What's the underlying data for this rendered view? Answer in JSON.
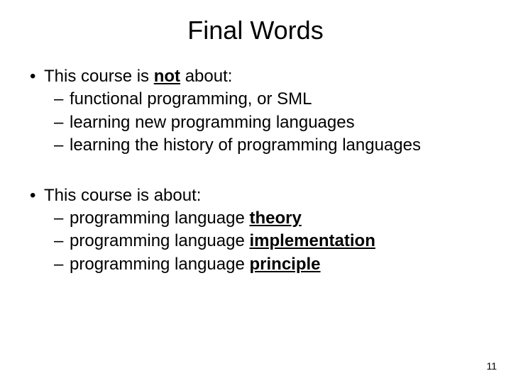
{
  "title": "Final Words",
  "section1": {
    "intro_pre": "This course is ",
    "intro_em": "not",
    "intro_post": " about:",
    "items": [
      "functional programming, or SML",
      "learning new programming languages",
      "learning the history of programming languages"
    ]
  },
  "section2": {
    "intro": "This course is about:",
    "items_pre": "programming language ",
    "items_em": [
      "theory",
      "implementation",
      "principle"
    ]
  },
  "page_number": "11"
}
